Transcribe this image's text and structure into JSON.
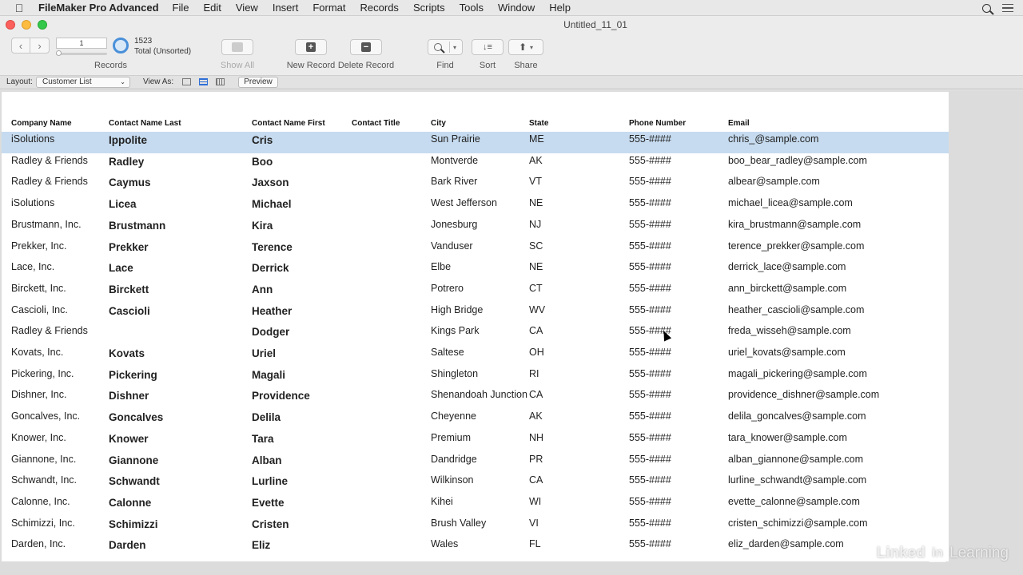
{
  "menubar": {
    "app_name": "FileMaker Pro Advanced",
    "items": [
      "File",
      "Edit",
      "View",
      "Insert",
      "Format",
      "Records",
      "Scripts",
      "Tools",
      "Window",
      "Help"
    ]
  },
  "window": {
    "title": "Untitled_11_01"
  },
  "toolbar": {
    "record_number": "1",
    "found_count": "1523",
    "found_status": "Total (Unsorted)",
    "records_label": "Records",
    "show_all_label": "Show All",
    "new_record_label": "New Record",
    "delete_record_label": "Delete Record",
    "find_label": "Find",
    "sort_label": "Sort",
    "share_label": "Share"
  },
  "layoutbar": {
    "layout_label": "Layout:",
    "layout_value": "Customer List",
    "view_as_label": "View As:",
    "preview_label": "Preview"
  },
  "table": {
    "headers": {
      "company": "Company Name",
      "last": "Contact Name Last",
      "first": "Contact Name First",
      "title": "Contact Title",
      "city": "City",
      "state": "State",
      "phone": "Phone Number",
      "email": "Email"
    },
    "rows": [
      {
        "company": "iSolutions",
        "last": "Ippolite",
        "first": "Cris",
        "title": "",
        "city": "Sun Prairie",
        "state": "ME",
        "phone": "555-####",
        "email": "chris_@sample.com"
      },
      {
        "company": "Radley & Friends",
        "last": "Radley",
        "first": "Boo",
        "title": "",
        "city": "Montverde",
        "state": "AK",
        "phone": "555-####",
        "email": "boo_bear_radley@sample.com"
      },
      {
        "company": "Radley & Friends",
        "last": "Caymus",
        "first": "Jaxson",
        "title": "",
        "city": "Bark River",
        "state": "VT",
        "phone": "555-####",
        "email": "albear@sample.com"
      },
      {
        "company": "iSolutions",
        "last": "Licea",
        "first": "Michael",
        "title": "",
        "city": "West Jefferson",
        "state": "NE",
        "phone": "555-####",
        "email": "michael_licea@sample.com"
      },
      {
        "company": "Brustmann, Inc.",
        "last": "Brustmann",
        "first": "Kira",
        "title": "",
        "city": "Jonesburg",
        "state": "NJ",
        "phone": "555-####",
        "email": "kira_brustmann@sample.com"
      },
      {
        "company": "Prekker, Inc.",
        "last": "Prekker",
        "first": "Terence",
        "title": "",
        "city": "Vanduser",
        "state": "SC",
        "phone": "555-####",
        "email": "terence_prekker@sample.com"
      },
      {
        "company": "Lace, Inc.",
        "last": "Lace",
        "first": "Derrick",
        "title": "",
        "city": "Elbe",
        "state": "NE",
        "phone": "555-####",
        "email": "derrick_lace@sample.com"
      },
      {
        "company": "Birckett, Inc.",
        "last": "Birckett",
        "first": "Ann",
        "title": "",
        "city": "Potrero",
        "state": "CT",
        "phone": "555-####",
        "email": "ann_birckett@sample.com"
      },
      {
        "company": "Cascioli, Inc.",
        "last": "Cascioli",
        "first": "Heather",
        "title": "",
        "city": "High Bridge",
        "state": "WV",
        "phone": "555-####",
        "email": "heather_cascioli@sample.com"
      },
      {
        "company": "Radley & Friends",
        "last": "",
        "first": "Dodger",
        "title": "",
        "city": "Kings Park",
        "state": "CA",
        "phone": "555-####",
        "email": "freda_wisseh@sample.com"
      },
      {
        "company": "Kovats, Inc.",
        "last": "Kovats",
        "first": "Uriel",
        "title": "",
        "city": "Saltese",
        "state": "OH",
        "phone": "555-####",
        "email": "uriel_kovats@sample.com"
      },
      {
        "company": "Pickering, Inc.",
        "last": "Pickering",
        "first": "Magali",
        "title": "",
        "city": "Shingleton",
        "state": "RI",
        "phone": "555-####",
        "email": "magali_pickering@sample.com"
      },
      {
        "company": "Dishner, Inc.",
        "last": "Dishner",
        "first": "Providence",
        "title": "",
        "city": "Shenandoah Junction",
        "state": "CA",
        "phone": "555-####",
        "email": "providence_dishner@sample.com"
      },
      {
        "company": "Goncalves, Inc.",
        "last": "Goncalves",
        "first": "Delila",
        "title": "",
        "city": "Cheyenne",
        "state": "AK",
        "phone": "555-####",
        "email": "delila_goncalves@sample.com"
      },
      {
        "company": "Knower, Inc.",
        "last": "Knower",
        "first": "Tara",
        "title": "",
        "city": "Premium",
        "state": "NH",
        "phone": "555-####",
        "email": "tara_knower@sample.com"
      },
      {
        "company": "Giannone, Inc.",
        "last": "Giannone",
        "first": "Alban",
        "title": "",
        "city": "Dandridge",
        "state": "PR",
        "phone": "555-####",
        "email": "alban_giannone@sample.com"
      },
      {
        "company": "Schwandt, Inc.",
        "last": "Schwandt",
        "first": "Lurline",
        "title": "",
        "city": "Wilkinson",
        "state": "CA",
        "phone": "555-####",
        "email": "lurline_schwandt@sample.com"
      },
      {
        "company": "Calonne, Inc.",
        "last": "Calonne",
        "first": "Evette",
        "title": "",
        "city": "Kihei",
        "state": "WI",
        "phone": "555-####",
        "email": "evette_calonne@sample.com"
      },
      {
        "company": "Schimizzi, Inc.",
        "last": "Schimizzi",
        "first": "Cristen",
        "title": "",
        "city": "Brush Valley",
        "state": "VI",
        "phone": "555-####",
        "email": "cristen_schimizzi@sample.com"
      },
      {
        "company": "Darden, Inc.",
        "last": "Darden",
        "first": "Eliz",
        "title": "",
        "city": "Wales",
        "state": "FL",
        "phone": "555-####",
        "email": "eliz_darden@sample.com"
      }
    ]
  },
  "watermark": {
    "part1": "Linked",
    "part2": "in",
    "part3": "Learning"
  },
  "colors": {
    "selection": "#c6dbef",
    "accent": "#2f6fd6"
  }
}
